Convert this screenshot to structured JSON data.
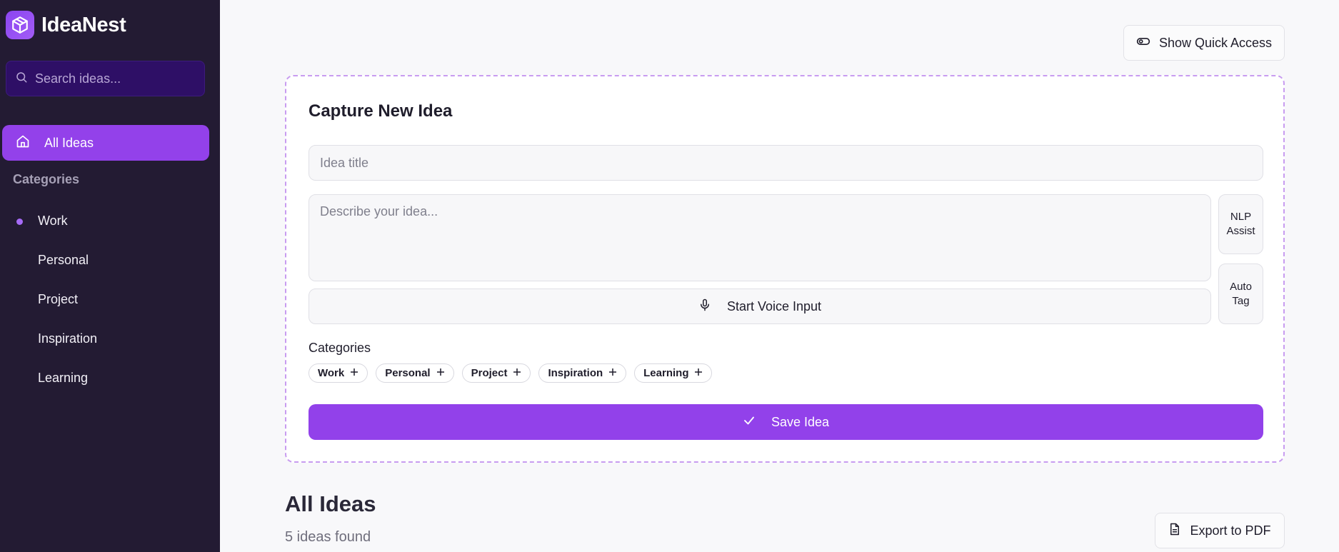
{
  "app": {
    "name": "IdeaNest",
    "accent": "#9341ea",
    "sidebar_bg": "#231b33"
  },
  "search": {
    "placeholder": "Search ideas..."
  },
  "nav": {
    "all_ideas": "All Ideas"
  },
  "sidebar": {
    "categories_heading": "Categories",
    "categories": [
      {
        "label": "Work",
        "active": true
      },
      {
        "label": "Personal",
        "active": false
      },
      {
        "label": "Project",
        "active": false
      },
      {
        "label": "Inspiration",
        "active": false
      },
      {
        "label": "Learning",
        "active": false
      }
    ]
  },
  "header": {
    "quick_access": "Show Quick Access"
  },
  "capture": {
    "title": "Capture New Idea",
    "title_placeholder": "Idea title",
    "description_placeholder": "Describe your idea...",
    "nlp_assist": "NLP\nAssist",
    "auto_tag": "Auto\nTag",
    "voice_input": "Start Voice Input",
    "categories_label": "Categories",
    "category_chips": [
      "Work",
      "Personal",
      "Project",
      "Inspiration",
      "Learning"
    ],
    "save": "Save Idea"
  },
  "ideas": {
    "title": "All Ideas",
    "count_text": "5 ideas found",
    "export": "Export to PDF"
  }
}
